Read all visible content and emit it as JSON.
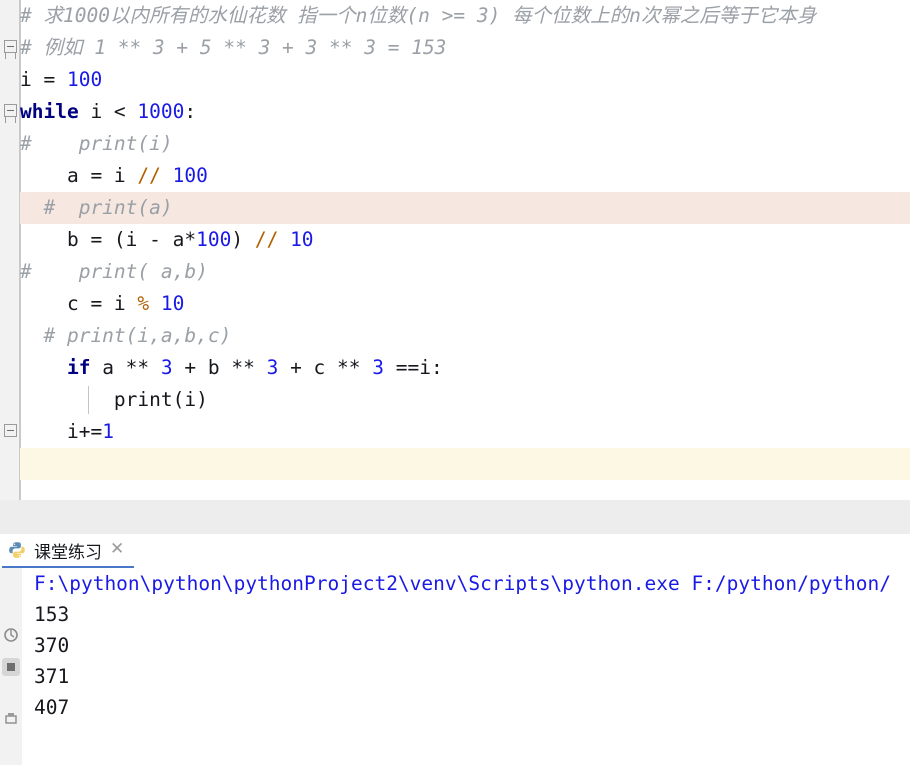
{
  "editor": {
    "lines": [
      {
        "id": "line-1",
        "highlight": "none",
        "indent_guides": [],
        "fold": "none",
        "tokens": [
          {
            "cls": "tok-com",
            "text": "# 求1000以内所有的水仙花数 指一个n位数(n >= 3) 每个位数上的n次幂之后等于它本身"
          }
        ]
      },
      {
        "id": "line-2",
        "highlight": "none",
        "indent_guides": [],
        "fold": "collapse",
        "tokens": [
          {
            "cls": "tok-com",
            "text": "# 例如 1 ** 3 + 5 ** 3 + 3 ** 3 = 153"
          }
        ]
      },
      {
        "id": "line-3",
        "highlight": "none",
        "indent_guides": [],
        "fold": "none",
        "tokens": [
          {
            "cls": "tok-txt",
            "text": "i = "
          },
          {
            "cls": "tok-num",
            "text": "100"
          }
        ]
      },
      {
        "id": "line-4",
        "highlight": "none",
        "indent_guides": [],
        "fold": "collapse",
        "tokens": [
          {
            "cls": "tok-kw",
            "text": "while"
          },
          {
            "cls": "tok-txt",
            "text": " i < "
          },
          {
            "cls": "tok-num",
            "text": "1000"
          },
          {
            "cls": "tok-txt",
            "text": ":"
          }
        ]
      },
      {
        "id": "line-5",
        "highlight": "none",
        "indent_guides": [],
        "fold": "none",
        "tokens": [
          {
            "cls": "tok-com",
            "text": "#    print(i)"
          }
        ]
      },
      {
        "id": "line-6",
        "highlight": "none",
        "indent_guides": [],
        "fold": "none",
        "tokens": [
          {
            "cls": "tok-txt",
            "text": "    a = i "
          },
          {
            "cls": "tok-opo",
            "text": "//"
          },
          {
            "cls": "tok-txt",
            "text": " "
          },
          {
            "cls": "tok-num",
            "text": "100"
          }
        ]
      },
      {
        "id": "line-7",
        "highlight": "pink",
        "indent_guides": [],
        "fold": "none",
        "tokens": [
          {
            "cls": "tok-com",
            "text": "  #  print(a)"
          }
        ]
      },
      {
        "id": "line-8",
        "highlight": "none",
        "indent_guides": [],
        "fold": "none",
        "tokens": [
          {
            "cls": "tok-txt",
            "text": "    b = (i - a*"
          },
          {
            "cls": "tok-num",
            "text": "100"
          },
          {
            "cls": "tok-txt",
            "text": ") "
          },
          {
            "cls": "tok-opo",
            "text": "//"
          },
          {
            "cls": "tok-txt",
            "text": " "
          },
          {
            "cls": "tok-num",
            "text": "10"
          }
        ]
      },
      {
        "id": "line-9",
        "highlight": "none",
        "indent_guides": [],
        "fold": "none",
        "tokens": [
          {
            "cls": "tok-com",
            "text": "#    print( a,b)"
          }
        ]
      },
      {
        "id": "line-10",
        "highlight": "none",
        "indent_guides": [],
        "fold": "none",
        "tokens": [
          {
            "cls": "tok-txt",
            "text": "    c = i "
          },
          {
            "cls": "tok-opo",
            "text": "%"
          },
          {
            "cls": "tok-txt",
            "text": " "
          },
          {
            "cls": "tok-num",
            "text": "10"
          }
        ]
      },
      {
        "id": "line-11",
        "highlight": "none",
        "indent_guides": [],
        "fold": "none",
        "tokens": [
          {
            "cls": "tok-com",
            "text": "  # print(i,a,b,c)"
          }
        ]
      },
      {
        "id": "line-12",
        "highlight": "none",
        "indent_guides": [],
        "fold": "none",
        "tokens": [
          {
            "cls": "tok-txt",
            "text": "    "
          },
          {
            "cls": "tok-kw",
            "text": "if"
          },
          {
            "cls": "tok-txt",
            "text": " a ** "
          },
          {
            "cls": "tok-num",
            "text": "3"
          },
          {
            "cls": "tok-txt",
            "text": " + b ** "
          },
          {
            "cls": "tok-num",
            "text": "3"
          },
          {
            "cls": "tok-txt",
            "text": " + c ** "
          },
          {
            "cls": "tok-num",
            "text": "3"
          },
          {
            "cls": "tok-txt",
            "text": " ==i:"
          }
        ]
      },
      {
        "id": "line-13",
        "highlight": "none",
        "indent_guides": [
          68
        ],
        "fold": "none",
        "tokens": [
          {
            "cls": "tok-txt",
            "text": "        print(i)"
          }
        ]
      },
      {
        "id": "line-14",
        "highlight": "none",
        "indent_guides": [],
        "fold": "end",
        "tokens": [
          {
            "cls": "tok-txt",
            "text": "    i+="
          },
          {
            "cls": "tok-num",
            "text": "1"
          }
        ]
      },
      {
        "id": "line-15",
        "highlight": "yellow",
        "indent_guides": [],
        "fold": "none",
        "tokens": [
          {
            "cls": "tok-txt",
            "text": ""
          }
        ]
      }
    ]
  },
  "run_panel": {
    "tab": {
      "icon": "python-logo-icon",
      "label": "课堂练习",
      "close_label": "✕"
    },
    "console": {
      "command_line": "F:\\python\\python\\pythonProject2\\venv\\Scripts\\python.exe F:/python/python/",
      "output": [
        "153",
        "370",
        "371",
        "407"
      ]
    },
    "toolbar_icons": [
      "rerun-icon",
      "stop-icon",
      "print-icon"
    ]
  },
  "colors": {
    "comment": "#9aa0a6",
    "keyword": "#000080",
    "number": "#1a1ae6",
    "text": "#16181d",
    "operator": "#b06000",
    "pink_highlight": "#f7e7e1",
    "yellow_highlight": "#fcf8e3",
    "gutter": "#f2f2f2",
    "tab_underline": "#4a78c8",
    "console_command": "#1a1ae6"
  }
}
